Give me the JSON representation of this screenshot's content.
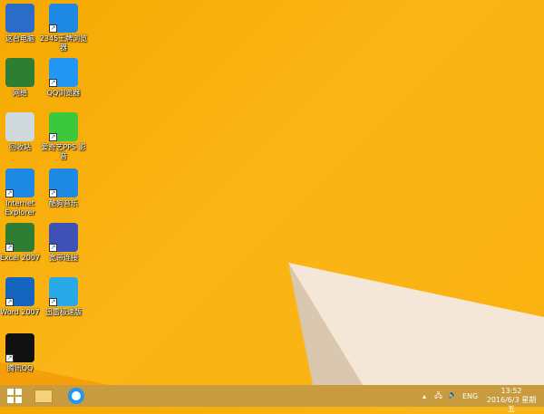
{
  "desktop": {
    "icons": [
      {
        "label": "这台电脑",
        "icon": "computer-icon",
        "color": "#2a6cc7"
      },
      {
        "label": "2345王牌浏览器",
        "icon": "browser-2345-icon",
        "color": "#1e88e5"
      },
      {
        "label": "网络",
        "icon": "network-icon",
        "color": "#2e7d32"
      },
      {
        "label": "QQ浏览器",
        "icon": "qq-browser-icon",
        "color": "#2196f3"
      },
      {
        "label": "回收站",
        "icon": "recycle-bin-icon",
        "color": "#cfd8dc"
      },
      {
        "label": "爱奇艺PPS 影音",
        "icon": "iqiyi-icon",
        "color": "#3cc83c"
      },
      {
        "label": "Internet Explorer",
        "icon": "ie-icon",
        "color": "#1e88e5"
      },
      {
        "label": "酷狗音乐",
        "icon": "kugou-icon",
        "color": "#1e88e5"
      },
      {
        "label": "Excel 2007",
        "icon": "excel-icon",
        "color": "#2e7d32"
      },
      {
        "label": "宽带连接",
        "icon": "broadband-icon",
        "color": "#3f51b5"
      },
      {
        "label": "Word 2007",
        "icon": "word-icon",
        "color": "#1565c0"
      },
      {
        "label": "迅雷极速版",
        "icon": "xunlei-icon",
        "color": "#29a9e8"
      },
      {
        "label": "腾讯QQ",
        "icon": "qq-icon",
        "color": "#111111"
      }
    ]
  },
  "taskbar": {
    "tray_lang": "ENG",
    "time": "13:52",
    "date": "2016/6/3 星期五"
  }
}
